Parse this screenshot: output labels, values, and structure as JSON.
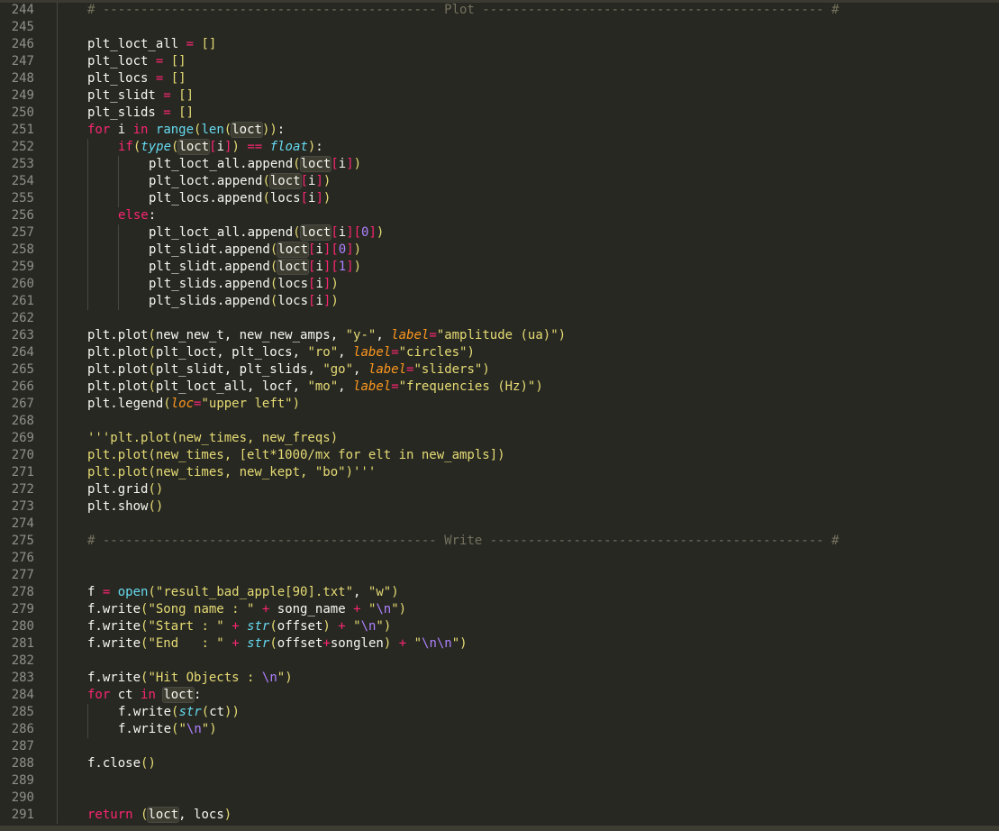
{
  "colors": {
    "background": "#272822",
    "keyword": "#f92672",
    "builtin": "#66d9ef",
    "string": "#e6db74",
    "number": "#ae81ff",
    "param": "#fd971f",
    "comment": "#75715e",
    "text": "#f8f8f2",
    "gutter_text": "#90908a"
  },
  "lines": [
    {
      "n": "244",
      "indent": 1,
      "tokens": [
        [
          "cmt",
          "# -------------------------------------------- Plot --------------------------------------------- #"
        ]
      ]
    },
    {
      "n": "245",
      "indent": 1,
      "tokens": []
    },
    {
      "n": "246",
      "indent": 1,
      "tokens": [
        [
          "plain",
          "plt_loct_all "
        ],
        [
          "op",
          "="
        ],
        [
          "plain",
          " "
        ],
        [
          "paren",
          "[]"
        ]
      ]
    },
    {
      "n": "247",
      "indent": 1,
      "tokens": [
        [
          "plain",
          "plt_loct "
        ],
        [
          "op",
          "="
        ],
        [
          "plain",
          " "
        ],
        [
          "paren",
          "[]"
        ]
      ]
    },
    {
      "n": "248",
      "indent": 1,
      "tokens": [
        [
          "plain",
          "plt_locs "
        ],
        [
          "op",
          "="
        ],
        [
          "plain",
          " "
        ],
        [
          "paren",
          "[]"
        ]
      ]
    },
    {
      "n": "249",
      "indent": 1,
      "tokens": [
        [
          "plain",
          "plt_slidt "
        ],
        [
          "op",
          "="
        ],
        [
          "plain",
          " "
        ],
        [
          "paren",
          "[]"
        ]
      ]
    },
    {
      "n": "250",
      "indent": 1,
      "tokens": [
        [
          "plain",
          "plt_slids "
        ],
        [
          "op",
          "="
        ],
        [
          "plain",
          " "
        ],
        [
          "paren",
          "[]"
        ]
      ]
    },
    {
      "n": "251",
      "indent": 1,
      "tokens": [
        [
          "kw",
          "for"
        ],
        [
          "plain",
          " i "
        ],
        [
          "kw",
          "in"
        ],
        [
          "plain",
          " "
        ],
        [
          "bi",
          "range"
        ],
        [
          "paren",
          "("
        ],
        [
          "bi",
          "len"
        ],
        [
          "paren",
          "("
        ],
        [
          "hl",
          "loct"
        ],
        [
          "paren",
          "))"
        ],
        [
          "plain",
          ":"
        ]
      ]
    },
    {
      "n": "252",
      "indent": 2,
      "tokens": [
        [
          "kw",
          "if"
        ],
        [
          "paren",
          "("
        ],
        [
          "type",
          "type"
        ],
        [
          "paren",
          "("
        ],
        [
          "hl",
          "loct"
        ],
        [
          "kw",
          "["
        ],
        [
          "plain",
          "i"
        ],
        [
          "kw",
          "]"
        ],
        [
          "paren",
          ")"
        ],
        [
          "plain",
          " "
        ],
        [
          "op",
          "=="
        ],
        [
          "plain",
          " "
        ],
        [
          "type",
          "float"
        ],
        [
          "paren",
          ")"
        ],
        [
          "plain",
          ":"
        ]
      ]
    },
    {
      "n": "253",
      "indent": 3,
      "tokens": [
        [
          "plain",
          "plt_loct_all.append"
        ],
        [
          "paren",
          "("
        ],
        [
          "hl",
          "loct"
        ],
        [
          "kw",
          "["
        ],
        [
          "plain",
          "i"
        ],
        [
          "kw",
          "]"
        ],
        [
          "paren",
          ")"
        ]
      ]
    },
    {
      "n": "254",
      "indent": 3,
      "tokens": [
        [
          "plain",
          "plt_loct.append"
        ],
        [
          "paren",
          "("
        ],
        [
          "hl",
          "loct"
        ],
        [
          "kw",
          "["
        ],
        [
          "plain",
          "i"
        ],
        [
          "kw",
          "]"
        ],
        [
          "paren",
          ")"
        ]
      ]
    },
    {
      "n": "255",
      "indent": 3,
      "tokens": [
        [
          "plain",
          "plt_locs.append"
        ],
        [
          "paren",
          "("
        ],
        [
          "plain",
          "locs"
        ],
        [
          "kw",
          "["
        ],
        [
          "plain",
          "i"
        ],
        [
          "kw",
          "]"
        ],
        [
          "paren",
          ")"
        ]
      ]
    },
    {
      "n": "256",
      "indent": 2,
      "tokens": [
        [
          "kw",
          "else"
        ],
        [
          "plain",
          ":"
        ]
      ]
    },
    {
      "n": "257",
      "indent": 3,
      "tokens": [
        [
          "plain",
          "plt_loct_all.append"
        ],
        [
          "paren",
          "("
        ],
        [
          "hl",
          "loct"
        ],
        [
          "kw",
          "["
        ],
        [
          "plain",
          "i"
        ],
        [
          "kw",
          "]["
        ],
        [
          "num",
          "0"
        ],
        [
          "kw",
          "]"
        ],
        [
          "paren",
          ")"
        ]
      ]
    },
    {
      "n": "258",
      "indent": 3,
      "tokens": [
        [
          "plain",
          "plt_slidt.append"
        ],
        [
          "paren",
          "("
        ],
        [
          "hl",
          "loct"
        ],
        [
          "kw",
          "["
        ],
        [
          "plain",
          "i"
        ],
        [
          "kw",
          "]["
        ],
        [
          "num",
          "0"
        ],
        [
          "kw",
          "]"
        ],
        [
          "paren",
          ")"
        ]
      ]
    },
    {
      "n": "259",
      "indent": 3,
      "tokens": [
        [
          "plain",
          "plt_slidt.append"
        ],
        [
          "paren",
          "("
        ],
        [
          "hl",
          "loct"
        ],
        [
          "kw",
          "["
        ],
        [
          "plain",
          "i"
        ],
        [
          "kw",
          "]["
        ],
        [
          "num",
          "1"
        ],
        [
          "kw",
          "]"
        ],
        [
          "paren",
          ")"
        ]
      ]
    },
    {
      "n": "260",
      "indent": 3,
      "tokens": [
        [
          "plain",
          "plt_slids.append"
        ],
        [
          "paren",
          "("
        ],
        [
          "plain",
          "locs"
        ],
        [
          "kw",
          "["
        ],
        [
          "plain",
          "i"
        ],
        [
          "kw",
          "]"
        ],
        [
          "paren",
          ")"
        ]
      ]
    },
    {
      "n": "261",
      "indent": 3,
      "tokens": [
        [
          "plain",
          "plt_slids.append"
        ],
        [
          "paren",
          "("
        ],
        [
          "plain",
          "locs"
        ],
        [
          "kw",
          "["
        ],
        [
          "plain",
          "i"
        ],
        [
          "kw",
          "]"
        ],
        [
          "paren",
          ")"
        ]
      ]
    },
    {
      "n": "262",
      "indent": 1,
      "tokens": []
    },
    {
      "n": "263",
      "indent": 1,
      "tokens": [
        [
          "plain",
          "plt.plot"
        ],
        [
          "paren",
          "("
        ],
        [
          "plain",
          "new_new_t, new_new_amps, "
        ],
        [
          "str",
          "\"y-\""
        ],
        [
          "plain",
          ", "
        ],
        [
          "param",
          "label"
        ],
        [
          "op",
          "="
        ],
        [
          "str",
          "\"amplitude (ua)\""
        ],
        [
          "paren",
          ")"
        ]
      ]
    },
    {
      "n": "264",
      "indent": 1,
      "tokens": [
        [
          "plain",
          "plt.plot"
        ],
        [
          "paren",
          "("
        ],
        [
          "plain",
          "plt_loct, plt_locs, "
        ],
        [
          "str",
          "\"ro\""
        ],
        [
          "plain",
          ", "
        ],
        [
          "param",
          "label"
        ],
        [
          "op",
          "="
        ],
        [
          "str",
          "\"circles\""
        ],
        [
          "paren",
          ")"
        ]
      ]
    },
    {
      "n": "265",
      "indent": 1,
      "tokens": [
        [
          "plain",
          "plt.plot"
        ],
        [
          "paren",
          "("
        ],
        [
          "plain",
          "plt_slidt, plt_slids, "
        ],
        [
          "str",
          "\"go\""
        ],
        [
          "plain",
          ", "
        ],
        [
          "param",
          "label"
        ],
        [
          "op",
          "="
        ],
        [
          "str",
          "\"sliders\""
        ],
        [
          "paren",
          ")"
        ]
      ]
    },
    {
      "n": "266",
      "indent": 1,
      "tokens": [
        [
          "plain",
          "plt.plot"
        ],
        [
          "paren",
          "("
        ],
        [
          "plain",
          "plt_loct_all, locf, "
        ],
        [
          "str",
          "\"mo\""
        ],
        [
          "plain",
          ", "
        ],
        [
          "param",
          "label"
        ],
        [
          "op",
          "="
        ],
        [
          "str",
          "\"frequencies (Hz)\""
        ],
        [
          "paren",
          ")"
        ]
      ]
    },
    {
      "n": "267",
      "indent": 1,
      "tokens": [
        [
          "plain",
          "plt.legend"
        ],
        [
          "paren",
          "("
        ],
        [
          "param",
          "loc"
        ],
        [
          "op",
          "="
        ],
        [
          "str",
          "\"upper left\""
        ],
        [
          "paren",
          ")"
        ]
      ]
    },
    {
      "n": "268",
      "indent": 1,
      "tokens": []
    },
    {
      "n": "269",
      "indent": 1,
      "tokens": [
        [
          "str",
          "'''plt.plot(new_times, new_freqs)"
        ]
      ]
    },
    {
      "n": "270",
      "indent": 1,
      "tokens": [
        [
          "str",
          "plt.plot(new_times, [elt*1000/mx for elt in new_ampls])"
        ]
      ]
    },
    {
      "n": "271",
      "indent": 1,
      "tokens": [
        [
          "str",
          "plt.plot(new_times, new_kept, \"bo\")'''"
        ]
      ]
    },
    {
      "n": "272",
      "indent": 1,
      "tokens": [
        [
          "plain",
          "plt.grid"
        ],
        [
          "paren",
          "()"
        ]
      ]
    },
    {
      "n": "273",
      "indent": 1,
      "tokens": [
        [
          "plain",
          "plt.show"
        ],
        [
          "paren",
          "()"
        ]
      ]
    },
    {
      "n": "274",
      "indent": 1,
      "tokens": []
    },
    {
      "n": "275",
      "indent": 1,
      "tokens": [
        [
          "cmt",
          "# -------------------------------------------- Write -------------------------------------------- #"
        ]
      ]
    },
    {
      "n": "276",
      "indent": 1,
      "tokens": []
    },
    {
      "n": "277",
      "indent": 1,
      "tokens": []
    },
    {
      "n": "278",
      "indent": 1,
      "tokens": [
        [
          "plain",
          "f "
        ],
        [
          "op",
          "="
        ],
        [
          "plain",
          " "
        ],
        [
          "bi",
          "open"
        ],
        [
          "paren",
          "("
        ],
        [
          "str",
          "\"result_bad_apple[90].txt\""
        ],
        [
          "plain",
          ", "
        ],
        [
          "str",
          "\"w\""
        ],
        [
          "paren",
          ")"
        ]
      ]
    },
    {
      "n": "279",
      "indent": 1,
      "tokens": [
        [
          "plain",
          "f.write"
        ],
        [
          "paren",
          "("
        ],
        [
          "str",
          "\"Song name : \""
        ],
        [
          "plain",
          " "
        ],
        [
          "op",
          "+"
        ],
        [
          "plain",
          " song_name "
        ],
        [
          "op",
          "+"
        ],
        [
          "plain",
          " "
        ],
        [
          "str",
          "\""
        ],
        [
          "esc",
          "\\n"
        ],
        [
          "str",
          "\""
        ],
        [
          "paren",
          ")"
        ]
      ]
    },
    {
      "n": "280",
      "indent": 1,
      "tokens": [
        [
          "plain",
          "f.write"
        ],
        [
          "paren",
          "("
        ],
        [
          "str",
          "\"Start : \""
        ],
        [
          "plain",
          " "
        ],
        [
          "op",
          "+"
        ],
        [
          "plain",
          " "
        ],
        [
          "type",
          "str"
        ],
        [
          "paren",
          "("
        ],
        [
          "plain",
          "offset"
        ],
        [
          "paren",
          ")"
        ],
        [
          "plain",
          " "
        ],
        [
          "op",
          "+"
        ],
        [
          "plain",
          " "
        ],
        [
          "str",
          "\""
        ],
        [
          "esc",
          "\\n"
        ],
        [
          "str",
          "\""
        ],
        [
          "paren",
          ")"
        ]
      ]
    },
    {
      "n": "281",
      "indent": 1,
      "tokens": [
        [
          "plain",
          "f.write"
        ],
        [
          "paren",
          "("
        ],
        [
          "str",
          "\"End   : \""
        ],
        [
          "plain",
          " "
        ],
        [
          "op",
          "+"
        ],
        [
          "plain",
          " "
        ],
        [
          "type",
          "str"
        ],
        [
          "paren",
          "("
        ],
        [
          "plain",
          "offset"
        ],
        [
          "op",
          "+"
        ],
        [
          "plain",
          "songlen"
        ],
        [
          "paren",
          ")"
        ],
        [
          "plain",
          " "
        ],
        [
          "op",
          "+"
        ],
        [
          "plain",
          " "
        ],
        [
          "str",
          "\""
        ],
        [
          "esc",
          "\\n\\n"
        ],
        [
          "str",
          "\""
        ],
        [
          "paren",
          ")"
        ]
      ]
    },
    {
      "n": "282",
      "indent": 1,
      "tokens": []
    },
    {
      "n": "283",
      "indent": 1,
      "tokens": [
        [
          "plain",
          "f.write"
        ],
        [
          "paren",
          "("
        ],
        [
          "str",
          "\"Hit Objects : "
        ],
        [
          "esc",
          "\\n"
        ],
        [
          "str",
          "\""
        ],
        [
          "paren",
          ")"
        ]
      ]
    },
    {
      "n": "284",
      "indent": 1,
      "tokens": [
        [
          "kw",
          "for"
        ],
        [
          "plain",
          " ct "
        ],
        [
          "kw",
          "in"
        ],
        [
          "plain",
          " "
        ],
        [
          "hl",
          "loct"
        ],
        [
          "plain",
          ":"
        ]
      ]
    },
    {
      "n": "285",
      "indent": 2,
      "tokens": [
        [
          "plain",
          "f.write"
        ],
        [
          "paren",
          "("
        ],
        [
          "type",
          "str"
        ],
        [
          "paren",
          "("
        ],
        [
          "plain",
          "ct"
        ],
        [
          "paren",
          "))"
        ]
      ]
    },
    {
      "n": "286",
      "indent": 2,
      "tokens": [
        [
          "plain",
          "f.write"
        ],
        [
          "paren",
          "("
        ],
        [
          "str",
          "\""
        ],
        [
          "esc",
          "\\n"
        ],
        [
          "str",
          "\""
        ],
        [
          "paren",
          ")"
        ]
      ]
    },
    {
      "n": "287",
      "indent": 1,
      "tokens": []
    },
    {
      "n": "288",
      "indent": 1,
      "tokens": [
        [
          "plain",
          "f.close"
        ],
        [
          "paren",
          "()"
        ]
      ]
    },
    {
      "n": "289",
      "indent": 1,
      "tokens": []
    },
    {
      "n": "290",
      "indent": 1,
      "tokens": []
    },
    {
      "n": "291",
      "indent": 1,
      "tokens": [
        [
          "kw",
          "return"
        ],
        [
          "plain",
          " "
        ],
        [
          "paren",
          "("
        ],
        [
          "hl",
          "loct"
        ],
        [
          "plain",
          ", locs"
        ],
        [
          "paren",
          ")"
        ]
      ]
    }
  ]
}
